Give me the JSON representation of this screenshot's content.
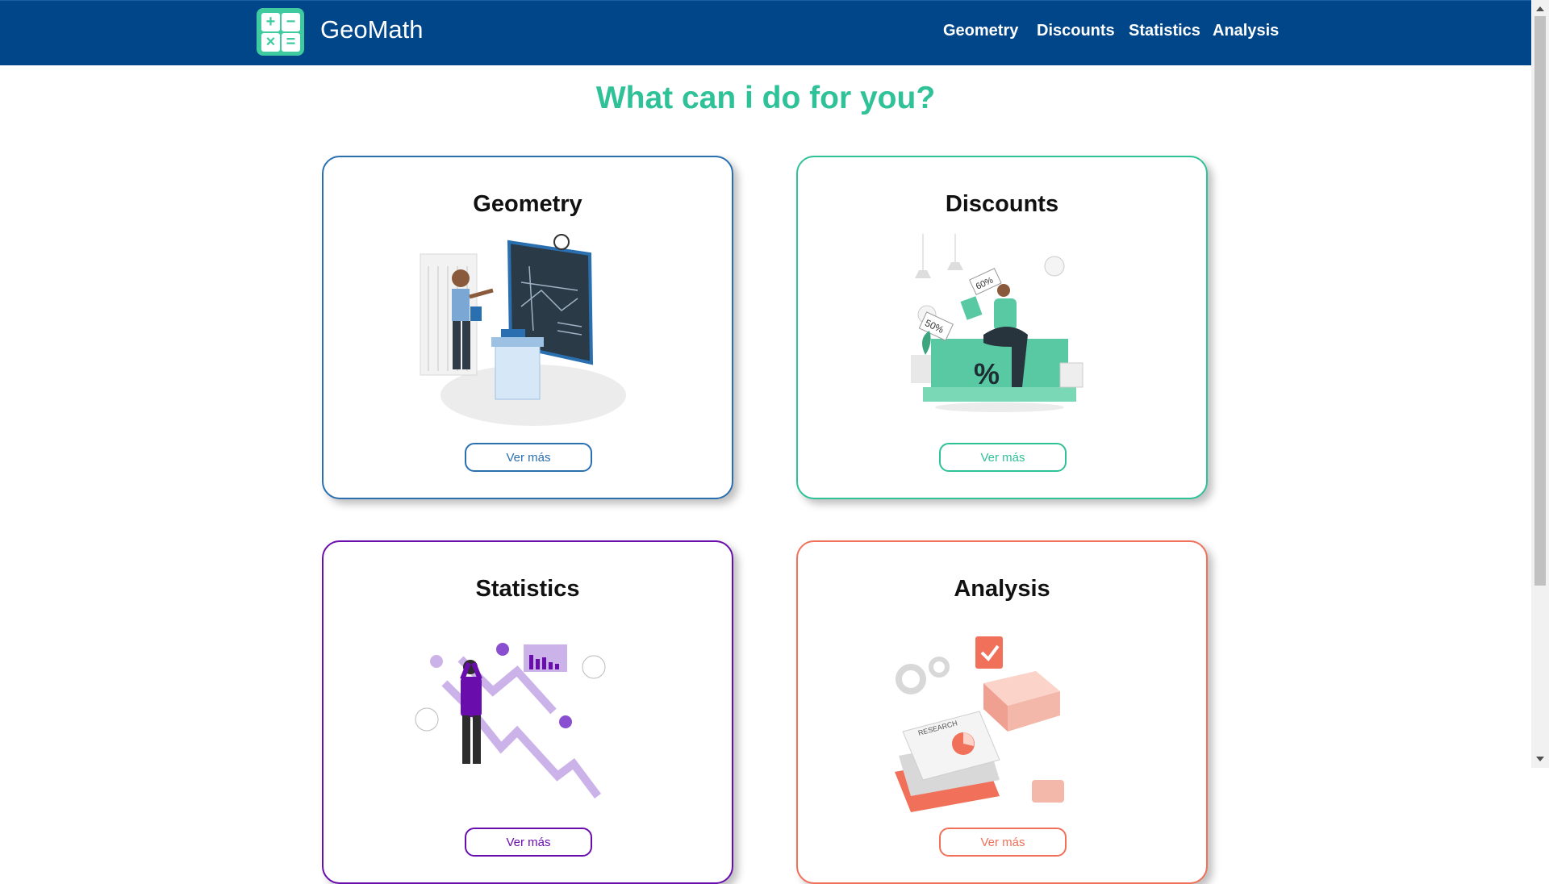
{
  "header": {
    "brand": "GeoMath",
    "logo_symbols": [
      "+",
      "−",
      "×",
      "="
    ],
    "nav": [
      "Geometry",
      "Discounts",
      "Statistics",
      "Analysis"
    ]
  },
  "main": {
    "title": "What can i do for you?",
    "cards": [
      {
        "title": "Geometry",
        "button": "Ver más",
        "accent": "#2a6fb0",
        "art_labels": []
      },
      {
        "title": "Discounts",
        "button": "Ver más",
        "accent": "#2fc197",
        "art_labels": [
          "60%",
          "50%",
          "%"
        ]
      },
      {
        "title": "Statistics",
        "button": "Ver más",
        "accent": "#6a0dad",
        "art_labels": []
      },
      {
        "title": "Analysis",
        "button": "Ver más",
        "accent": "#f0705a",
        "art_labels": [
          "RESEARCH"
        ]
      }
    ]
  },
  "colors": {
    "navbar": "#02468a",
    "title": "#2fc197"
  }
}
